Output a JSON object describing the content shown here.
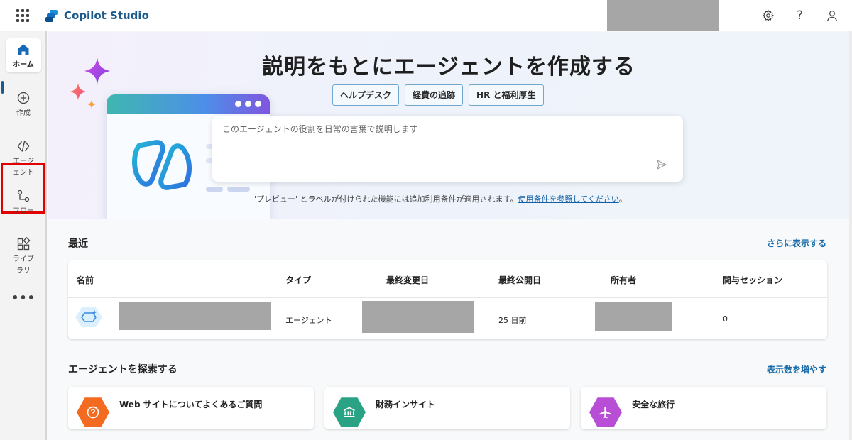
{
  "app": {
    "title": "Copilot Studio"
  },
  "topbar": {
    "settings_icon": "gear-icon",
    "help_label": "?",
    "account_icon": "person-icon"
  },
  "rail": {
    "items": [
      {
        "id": "home",
        "label": "ホーム",
        "icon": "home-icon"
      },
      {
        "id": "create",
        "label": "作成",
        "icon": "plus-circle-icon"
      },
      {
        "id": "agents",
        "label": "エージェント",
        "icon": "agent-icon"
      },
      {
        "id": "flows",
        "label": "フロー",
        "icon": "flow-icon"
      },
      {
        "id": "library",
        "label": "ライブラリ",
        "icon": "library-icon"
      }
    ],
    "more_label": "•••"
  },
  "hero": {
    "title": "説明をもとにエージェントを作成する",
    "chips": [
      "ヘルプデスク",
      "経費の追跡",
      "HR と福利厚生"
    ],
    "prompt_placeholder": "このエージェントの役割を日常の言葉で説明します",
    "note_prefix": "'プレビュー' とラベルが付けられた機能には追加利用条件が適用されます。",
    "note_link": "使用条件を参照してください",
    "note_suffix": "。"
  },
  "recent": {
    "title": "最近",
    "more_link": "さらに表示する",
    "columns": [
      "名前",
      "タイプ",
      "最終変更日",
      "最終公開日",
      "所有者",
      "関与セッション"
    ],
    "rows": [
      {
        "type": "エージェント",
        "published": "25 日前",
        "sessions": "0"
      }
    ]
  },
  "explore": {
    "title": "エージェントを探索する",
    "more_link": "表示数を増やす",
    "cards": [
      {
        "title": "Web サイトについてよくあるご質問",
        "icon": "question-icon",
        "color": "#f26b21"
      },
      {
        "title": "財務インサイト",
        "icon": "bank-icon",
        "color": "#2aa384"
      },
      {
        "title": "安全な旅行",
        "icon": "airplane-icon",
        "color": "#b94ed6"
      }
    ]
  }
}
